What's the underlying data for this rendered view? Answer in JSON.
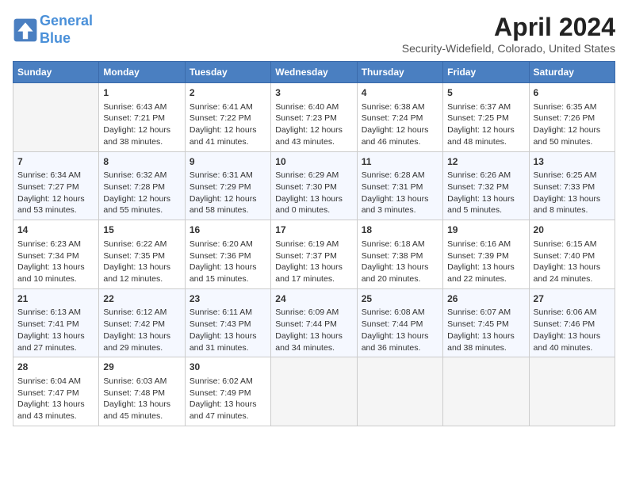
{
  "header": {
    "logo_line1": "General",
    "logo_line2": "Blue",
    "month": "April 2024",
    "location": "Security-Widefield, Colorado, United States"
  },
  "weekdays": [
    "Sunday",
    "Monday",
    "Tuesday",
    "Wednesday",
    "Thursday",
    "Friday",
    "Saturday"
  ],
  "weeks": [
    [
      {
        "day": "",
        "empty": true
      },
      {
        "day": "1",
        "sunrise": "6:43 AM",
        "sunset": "7:21 PM",
        "daylight": "12 hours and 38 minutes."
      },
      {
        "day": "2",
        "sunrise": "6:41 AM",
        "sunset": "7:22 PM",
        "daylight": "12 hours and 41 minutes."
      },
      {
        "day": "3",
        "sunrise": "6:40 AM",
        "sunset": "7:23 PM",
        "daylight": "12 hours and 43 minutes."
      },
      {
        "day": "4",
        "sunrise": "6:38 AM",
        "sunset": "7:24 PM",
        "daylight": "12 hours and 46 minutes."
      },
      {
        "day": "5",
        "sunrise": "6:37 AM",
        "sunset": "7:25 PM",
        "daylight": "12 hours and 48 minutes."
      },
      {
        "day": "6",
        "sunrise": "6:35 AM",
        "sunset": "7:26 PM",
        "daylight": "12 hours and 50 minutes."
      }
    ],
    [
      {
        "day": "7",
        "sunrise": "6:34 AM",
        "sunset": "7:27 PM",
        "daylight": "12 hours and 53 minutes."
      },
      {
        "day": "8",
        "sunrise": "6:32 AM",
        "sunset": "7:28 PM",
        "daylight": "12 hours and 55 minutes."
      },
      {
        "day": "9",
        "sunrise": "6:31 AM",
        "sunset": "7:29 PM",
        "daylight": "12 hours and 58 minutes."
      },
      {
        "day": "10",
        "sunrise": "6:29 AM",
        "sunset": "7:30 PM",
        "daylight": "13 hours and 0 minutes."
      },
      {
        "day": "11",
        "sunrise": "6:28 AM",
        "sunset": "7:31 PM",
        "daylight": "13 hours and 3 minutes."
      },
      {
        "day": "12",
        "sunrise": "6:26 AM",
        "sunset": "7:32 PM",
        "daylight": "13 hours and 5 minutes."
      },
      {
        "day": "13",
        "sunrise": "6:25 AM",
        "sunset": "7:33 PM",
        "daylight": "13 hours and 8 minutes."
      }
    ],
    [
      {
        "day": "14",
        "sunrise": "6:23 AM",
        "sunset": "7:34 PM",
        "daylight": "13 hours and 10 minutes."
      },
      {
        "day": "15",
        "sunrise": "6:22 AM",
        "sunset": "7:35 PM",
        "daylight": "13 hours and 12 minutes."
      },
      {
        "day": "16",
        "sunrise": "6:20 AM",
        "sunset": "7:36 PM",
        "daylight": "13 hours and 15 minutes."
      },
      {
        "day": "17",
        "sunrise": "6:19 AM",
        "sunset": "7:37 PM",
        "daylight": "13 hours and 17 minutes."
      },
      {
        "day": "18",
        "sunrise": "6:18 AM",
        "sunset": "7:38 PM",
        "daylight": "13 hours and 20 minutes."
      },
      {
        "day": "19",
        "sunrise": "6:16 AM",
        "sunset": "7:39 PM",
        "daylight": "13 hours and 22 minutes."
      },
      {
        "day": "20",
        "sunrise": "6:15 AM",
        "sunset": "7:40 PM",
        "daylight": "13 hours and 24 minutes."
      }
    ],
    [
      {
        "day": "21",
        "sunrise": "6:13 AM",
        "sunset": "7:41 PM",
        "daylight": "13 hours and 27 minutes."
      },
      {
        "day": "22",
        "sunrise": "6:12 AM",
        "sunset": "7:42 PM",
        "daylight": "13 hours and 29 minutes."
      },
      {
        "day": "23",
        "sunrise": "6:11 AM",
        "sunset": "7:43 PM",
        "daylight": "13 hours and 31 minutes."
      },
      {
        "day": "24",
        "sunrise": "6:09 AM",
        "sunset": "7:44 PM",
        "daylight": "13 hours and 34 minutes."
      },
      {
        "day": "25",
        "sunrise": "6:08 AM",
        "sunset": "7:44 PM",
        "daylight": "13 hours and 36 minutes."
      },
      {
        "day": "26",
        "sunrise": "6:07 AM",
        "sunset": "7:45 PM",
        "daylight": "13 hours and 38 minutes."
      },
      {
        "day": "27",
        "sunrise": "6:06 AM",
        "sunset": "7:46 PM",
        "daylight": "13 hours and 40 minutes."
      }
    ],
    [
      {
        "day": "28",
        "sunrise": "6:04 AM",
        "sunset": "7:47 PM",
        "daylight": "13 hours and 43 minutes."
      },
      {
        "day": "29",
        "sunrise": "6:03 AM",
        "sunset": "7:48 PM",
        "daylight": "13 hours and 45 minutes."
      },
      {
        "day": "30",
        "sunrise": "6:02 AM",
        "sunset": "7:49 PM",
        "daylight": "13 hours and 47 minutes."
      },
      {
        "day": "",
        "empty": true
      },
      {
        "day": "",
        "empty": true
      },
      {
        "day": "",
        "empty": true
      },
      {
        "day": "",
        "empty": true
      }
    ]
  ]
}
